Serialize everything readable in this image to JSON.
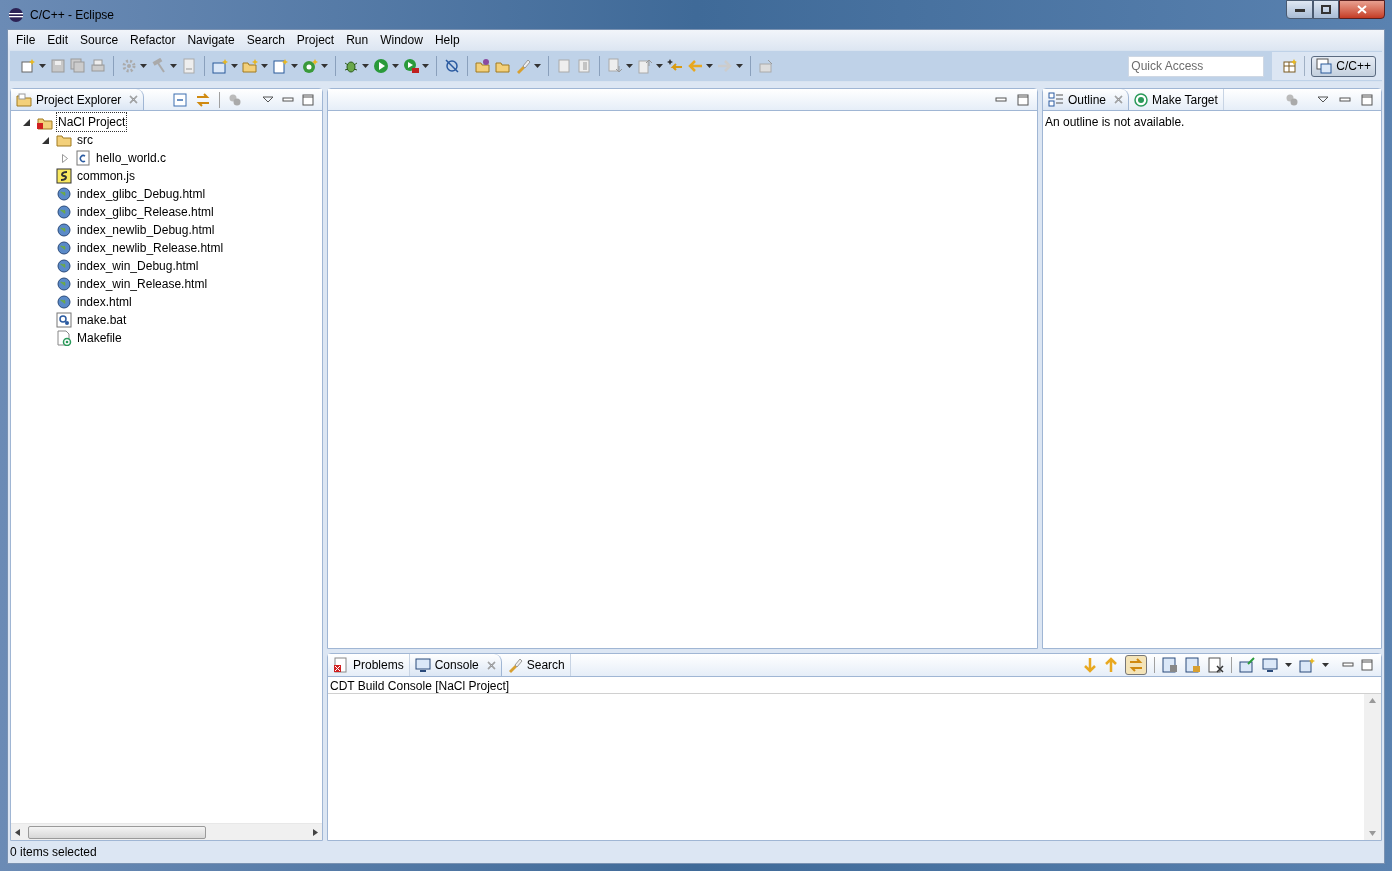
{
  "window": {
    "title": "C/C++ - Eclipse"
  },
  "menu": [
    "File",
    "Edit",
    "Source",
    "Refactor",
    "Navigate",
    "Search",
    "Project",
    "Run",
    "Window",
    "Help"
  ],
  "quick_access": {
    "placeholder": "Quick Access"
  },
  "perspectives": [
    {
      "label": "C/C++",
      "selected": true
    }
  ],
  "project_explorer": {
    "tabs": [
      {
        "label": "Project Explorer",
        "selected": true
      }
    ],
    "tree": [
      {
        "label": "NaCl Project",
        "kind": "project",
        "selected": true,
        "expanded": true,
        "children": [
          {
            "label": "src",
            "kind": "folder",
            "expanded": true,
            "children": [
              {
                "label": "hello_world.c",
                "kind": "c-file",
                "expanded": false
              }
            ]
          },
          {
            "label": "common.js",
            "kind": "js-file"
          },
          {
            "label": "index_glibc_Debug.html",
            "kind": "html-file"
          },
          {
            "label": "index_glibc_Release.html",
            "kind": "html-file"
          },
          {
            "label": "index_newlib_Debug.html",
            "kind": "html-file"
          },
          {
            "label": "index_newlib_Release.html",
            "kind": "html-file"
          },
          {
            "label": "index_win_Debug.html",
            "kind": "html-file"
          },
          {
            "label": "index_win_Release.html",
            "kind": "html-file"
          },
          {
            "label": "index.html",
            "kind": "html-file"
          },
          {
            "label": "make.bat",
            "kind": "bat-file"
          },
          {
            "label": "Makefile",
            "kind": "makefile"
          }
        ]
      }
    ]
  },
  "outline": {
    "tabs": [
      {
        "label": "Outline",
        "selected": true,
        "kind": "outline"
      },
      {
        "label": "Make Target",
        "selected": false,
        "kind": "target"
      }
    ],
    "message": "An outline is not available."
  },
  "bottom_panel": {
    "tabs": [
      {
        "label": "Problems",
        "selected": false,
        "kind": "problems"
      },
      {
        "label": "Console",
        "selected": true,
        "kind": "console"
      },
      {
        "label": "Search",
        "selected": false,
        "kind": "search"
      }
    ],
    "console_title": "CDT Build Console [NaCl Project]"
  },
  "status_bar": "0 items selected"
}
